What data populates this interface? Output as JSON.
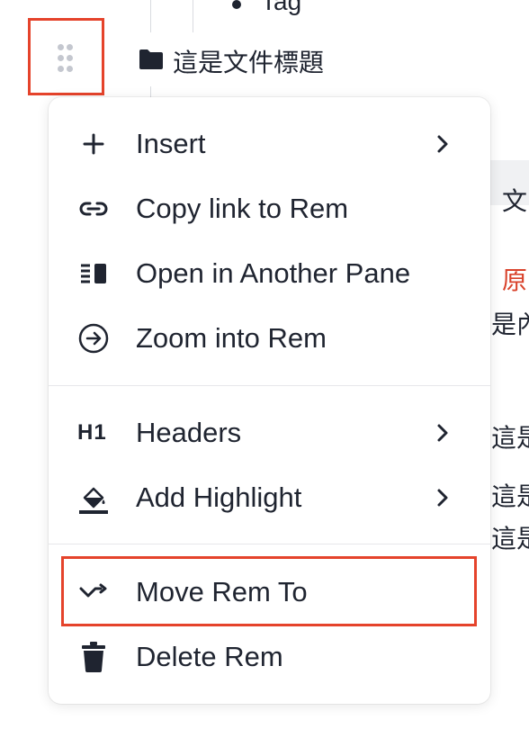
{
  "document": {
    "bullet_text": "Tag",
    "title": "這是文件標題",
    "right_fragments": [
      "文",
      "原",
      "是內",
      "這是",
      "這是",
      "這是"
    ]
  },
  "menu": {
    "items": [
      {
        "label": "Insert",
        "icon": "plus-icon",
        "has_submenu": true
      },
      {
        "label": "Copy link to Rem",
        "icon": "link-icon",
        "has_submenu": false
      },
      {
        "label": "Open in Another Pane",
        "icon": "pane-icon",
        "has_submenu": false
      },
      {
        "label": "Zoom into Rem",
        "icon": "zoom-in-icon",
        "has_submenu": false
      },
      {
        "label": "Headers",
        "icon": "h1-icon",
        "has_submenu": true
      },
      {
        "label": "Add Highlight",
        "icon": "highlight-icon",
        "has_submenu": true
      },
      {
        "label": "Move Rem To",
        "icon": "move-icon",
        "has_submenu": false,
        "highlighted": true
      },
      {
        "label": "Delete Rem",
        "icon": "trash-icon",
        "has_submenu": false
      }
    ],
    "h1_glyph": "H1"
  },
  "colors": {
    "highlight_outline": "#e5432b",
    "text": "#1f2430",
    "accent_red_text": "#d9422b"
  }
}
